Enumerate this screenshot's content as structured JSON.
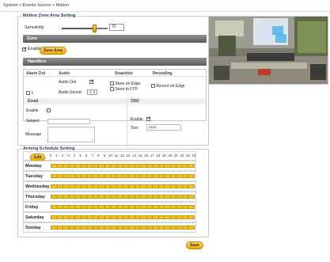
{
  "breadcrumb": "System > Events Source > Motion",
  "motion_zone": {
    "legend": "Motion Zone Area Setting",
    "sensitivity_label": "Sensitivity",
    "sensitivity_value": "72",
    "sensitivity_fraction": 0.72,
    "zone_header": "Zone",
    "enable_label": "Enable",
    "enable_checked": true,
    "save_area_label": "Save Area",
    "handlers_header": "Handlers"
  },
  "handlers": {
    "col_alarm_out": "Alarm Out",
    "col_audio": "Audio",
    "col_snapshot": "Snapshot",
    "col_recording": "Recording",
    "alarm_out_value": "1",
    "audio_out_label": "Audio Out",
    "audio_out_checked": true,
    "audio_sound_label": "Audio Sound",
    "audio_sound_value": "1",
    "store_on_edge_label": "Store on Edge",
    "store_to_ftp_label": "Store to FTP",
    "record_on_edge_label": "Record on Edge"
  },
  "email": {
    "header": "Email",
    "enable_label": "Enable",
    "subject_label": "Subject",
    "message_label": "Message"
  },
  "osd": {
    "header": "OSD",
    "enable_label": "Enable",
    "enable_checked": true,
    "text_label": "Text",
    "text_value": "xxxx"
  },
  "schedule": {
    "legend": "Arming Schedule Setting",
    "edit_label": "Edit",
    "hours": [
      "0",
      "1",
      "2",
      "3",
      "4",
      "5",
      "6",
      "7",
      "8",
      "9",
      "10",
      "11",
      "12",
      "13",
      "14",
      "15",
      "16",
      "17",
      "18",
      "19",
      "20",
      "21",
      "22",
      "23",
      "24"
    ],
    "days": [
      "Monday",
      "Tuesday",
      "Wednesday",
      "Thursday",
      "Friday",
      "Saturday",
      "Sunday"
    ]
  },
  "save_label": "Save",
  "colors": {
    "accent_orange": "#f0a400",
    "schedule_bar": "#f2c021",
    "legend_text": "#2b3a7a",
    "header_gray": "#6f6f6f"
  }
}
